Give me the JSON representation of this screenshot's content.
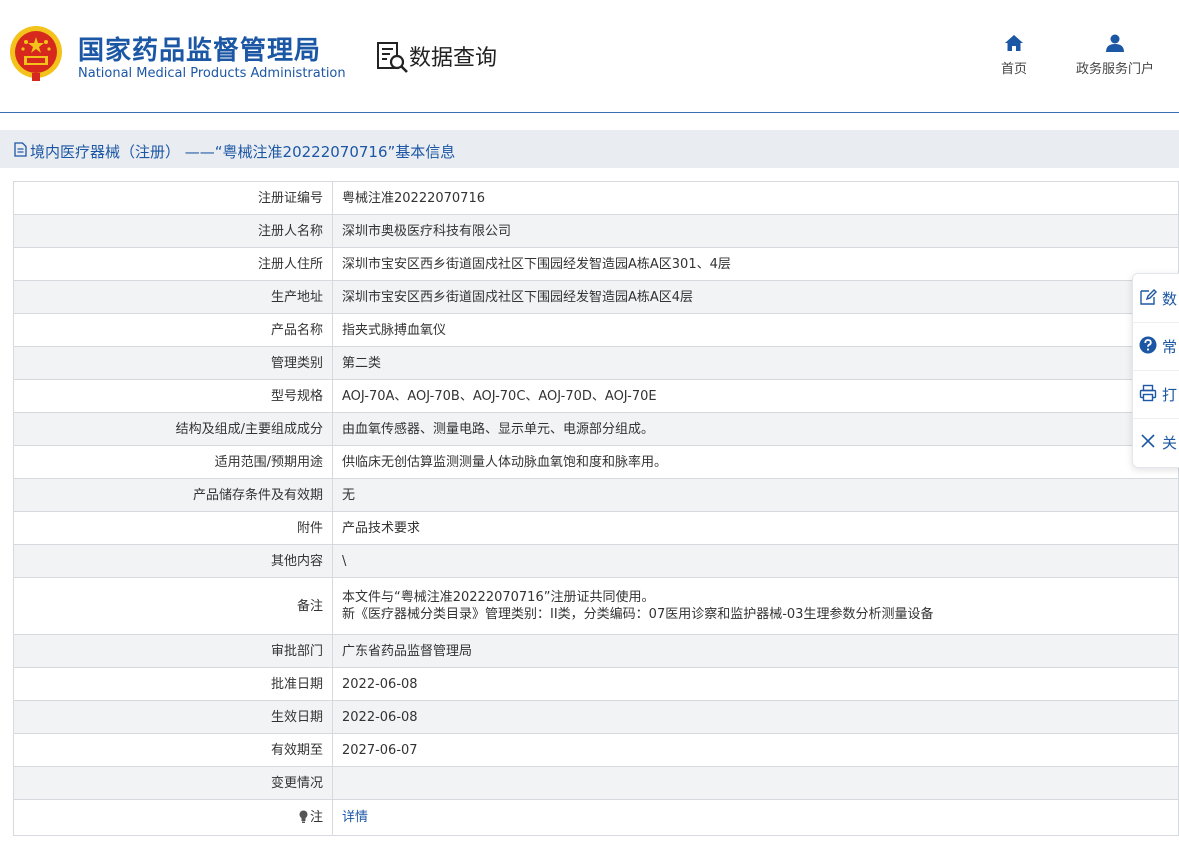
{
  "header": {
    "brand_cn": "国家药品监督管理局",
    "brand_en": "National Medical Products Administration",
    "section_title": "数据查询",
    "nav": [
      {
        "label": "首页",
        "icon": "home-icon"
      },
      {
        "label": "政务服务门户",
        "icon": "user-icon"
      }
    ]
  },
  "title_bar": {
    "text": "境内医疗器械（注册） ——“粤械注准20222070716”基本信息",
    "icon": "document-icon"
  },
  "table": {
    "rows": [
      {
        "key": "注册证编号",
        "value": "粤械注准20222070716"
      },
      {
        "key": "注册人名称",
        "value": "深圳市奥极医疗科技有限公司"
      },
      {
        "key": "注册人住所",
        "value": "深圳市宝安区西乡街道固戍社区下围园经发智造园A栋A区301、4层"
      },
      {
        "key": "生产地址",
        "value": "深圳市宝安区西乡街道固戍社区下围园经发智造园A栋A区4层"
      },
      {
        "key": "产品名称",
        "value": "指夹式脉搏血氧仪"
      },
      {
        "key": "管理类别",
        "value": "第二类"
      },
      {
        "key": "型号规格",
        "value": "AOJ-70A、AOJ-70B、AOJ-70C、AOJ-70D、AOJ-70E"
      },
      {
        "key": "结构及组成/主要组成成分",
        "value": "由血氧传感器、测量电路、显示单元、电源部分组成。"
      },
      {
        "key": "适用范围/预期用途",
        "value": "供临床无创估算监测测量人体动脉血氧饱和度和脉率用。"
      },
      {
        "key": "产品储存条件及有效期",
        "value": "无"
      },
      {
        "key": "附件",
        "value": "产品技术要求"
      },
      {
        "key": "其他内容",
        "value": "\\"
      },
      {
        "key": "备注",
        "value_line1": "本文件与“粤械注准20222070716”注册证共同使用。",
        "value_line2": "新《医疗器械分类目录》管理类别：II类，分类编码：07医用诊察和监护器械-03生理参数分析测量设备"
      },
      {
        "key": "审批部门",
        "value": "广东省药品监督管理局"
      },
      {
        "key": "批准日期",
        "value": "2022-06-08"
      },
      {
        "key": "生效日期",
        "value": "2022-06-08"
      },
      {
        "key": "有效期至",
        "value": "2027-06-07"
      },
      {
        "key": "变更情况",
        "value": ""
      },
      {
        "key": "注",
        "value": "详情",
        "key_icon": "lightbulb-icon"
      }
    ]
  },
  "side_panel": {
    "items": [
      {
        "label": "数",
        "icon": "edit-icon"
      },
      {
        "label": "常",
        "icon": "question-icon"
      },
      {
        "label": "打",
        "icon": "print-icon"
      },
      {
        "label": "关",
        "icon": "close-icon"
      }
    ]
  },
  "colors": {
    "brand_blue": "#1c57a5",
    "emblem_red": "#d6281c",
    "emblem_gold": "#f3c21b",
    "title_bar_bg": "#e9ecf0"
  }
}
